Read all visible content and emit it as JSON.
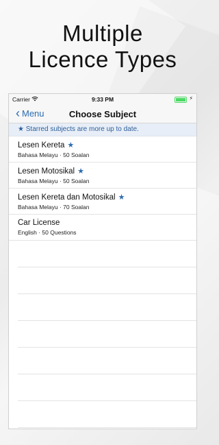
{
  "promo": {
    "line1": "Multiple",
    "line2": "Licence Types"
  },
  "status": {
    "carrier": "Carrier",
    "time": "9:33 PM"
  },
  "nav": {
    "back_label": "Menu",
    "title": "Choose Subject"
  },
  "notice": "★ Starred subjects are more up to date.",
  "items": [
    {
      "title": "Lesen Kereta",
      "starred": "★",
      "subtitle": "Bahasa Melayu · 50 Soalan"
    },
    {
      "title": "Lesen Motosikal",
      "starred": "★",
      "subtitle": "Bahasa Melayu · 50 Soalan"
    },
    {
      "title": "Lesen Kereta dan Motosikal",
      "starred": "★",
      "subtitle": "Bahasa Melayu · 70 Soalan"
    },
    {
      "title": "Car License",
      "starred": "",
      "subtitle": "English · 50 Questions"
    }
  ],
  "colors": {
    "accent": "#2b6cb0",
    "battery": "#4cd964",
    "notice_bg": "#e8eef7"
  },
  "icons": [
    "wifi-icon",
    "battery-icon",
    "charging-bolt-icon",
    "chevron-left-icon",
    "star-icon"
  ]
}
